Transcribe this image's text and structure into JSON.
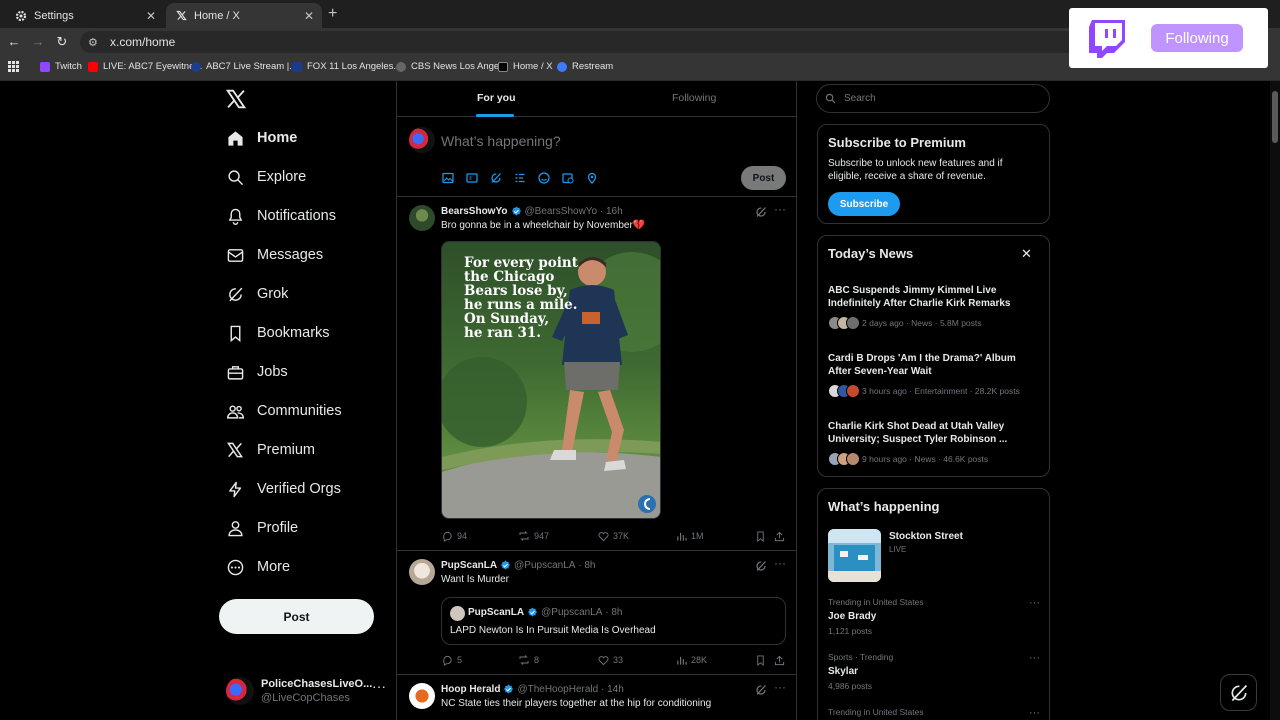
{
  "browser": {
    "tabs": [
      {
        "title": "Settings",
        "active": false
      },
      {
        "title": "Home / X",
        "active": true
      }
    ],
    "url": "x.com/home",
    "bookmarks": [
      {
        "label": "Twitch",
        "color": "#9146ff"
      },
      {
        "label": "LIVE: ABC7 Eyewitne...",
        "color": "#ff0000"
      },
      {
        "label": "ABC7 Live Stream |...",
        "color": "#1b3f8b"
      },
      {
        "label": "FOX 11 Los Angeles...",
        "color": "#1a3a8f"
      },
      {
        "label": "CBS News Los Ange...",
        "color": "#666666"
      },
      {
        "label": "Home / X",
        "color": "#000000"
      },
      {
        "label": "Restream",
        "color": "#3d7bfd"
      }
    ]
  },
  "twitch_overlay": {
    "button": "Following",
    "accent": "#bf94ff",
    "logo_color": "#9146ff"
  },
  "nav": {
    "items": [
      {
        "label": "Home",
        "icon": "home-icon"
      },
      {
        "label": "Explore",
        "icon": "search-icon"
      },
      {
        "label": "Notifications",
        "icon": "bell-icon"
      },
      {
        "label": "Messages",
        "icon": "envelope-icon"
      },
      {
        "label": "Grok",
        "icon": "grok-icon"
      },
      {
        "label": "Bookmarks",
        "icon": "bookmark-icon"
      },
      {
        "label": "Jobs",
        "icon": "briefcase-icon"
      },
      {
        "label": "Communities",
        "icon": "people-icon"
      },
      {
        "label": "Premium",
        "icon": "x-logo-icon"
      },
      {
        "label": "Verified Orgs",
        "icon": "bolt-icon"
      },
      {
        "label": "Profile",
        "icon": "person-icon"
      },
      {
        "label": "More",
        "icon": "more-circle-icon"
      }
    ],
    "post_button": "Post",
    "account": {
      "name": "PoliceChasesLiveO...",
      "handle": "@LiveCopChases"
    }
  },
  "feed": {
    "tabs": [
      "For you",
      "Following"
    ],
    "compose": {
      "placeholder": "What’s happening?",
      "post_button": "Post"
    },
    "tweets": [
      {
        "name": "BearsShowYo",
        "handle": "@BearsShowYo",
        "time": "16h",
        "text": "Bro gonna be in a wheelchair by November💔",
        "image_text": [
          "For every point",
          "the Chicago",
          "Bears lose by,",
          "he runs a mile.",
          "On Sunday,",
          "he ran 31."
        ],
        "replies": "94",
        "reposts": "947",
        "likes": "37K",
        "views": "1M"
      },
      {
        "name": "PupScanLA",
        "handle": "@PupscanLA",
        "time": "8h",
        "text": "Want Is Murder",
        "quote": {
          "name": "PupScanLA",
          "handle": "@PupscanLA",
          "time": "8h",
          "text": "LAPD Newton Is In Pursuit Media Is Overhead"
        },
        "replies": "5",
        "reposts": "8",
        "likes": "33",
        "views": "28K"
      },
      {
        "name": "Hoop Herald",
        "handle": "@TheHoopHerald",
        "time": "14h",
        "text": "NC State ties their players together at the hip for conditioning"
      }
    ]
  },
  "sidebar": {
    "search_placeholder": "Search",
    "premium": {
      "title": "Subscribe to Premium",
      "text": "Subscribe to unlock new features and if eligible, receive a share of revenue.",
      "button": "Subscribe"
    },
    "news": {
      "title": "Today’s News",
      "items": [
        {
          "headline": "ABC Suspends Jimmy Kimmel Live Indefinitely After Charlie Kirk Remarks",
          "meta": "2 days ago · News · 5.8M posts"
        },
        {
          "headline": "Cardi B Drops 'Am I the Drama?' Album After Seven-Year Wait",
          "meta": "3 hours ago · Entertainment · 28.2K posts"
        },
        {
          "headline": "Charlie Kirk Shot Dead at Utah Valley University; Suspect Tyler Robinson ...",
          "meta": "9 hours ago · News · 46.6K posts"
        }
      ]
    },
    "happening": {
      "title": "What’s happening",
      "live_event": {
        "name": "Stockton Street",
        "status": "LIVE"
      },
      "trends": [
        {
          "context": "Trending in United States",
          "name": "Joe Brady",
          "posts": "1,121 posts"
        },
        {
          "context": "Sports · Trending",
          "name": "Skylar",
          "posts": "4,986 posts"
        },
        {
          "context": "Trending in United States",
          "name": "",
          "posts": ""
        }
      ]
    }
  },
  "colors": {
    "accent": "#1d9bf0",
    "background": "#000000",
    "border": "#2f3336",
    "muted": "#71767b"
  }
}
